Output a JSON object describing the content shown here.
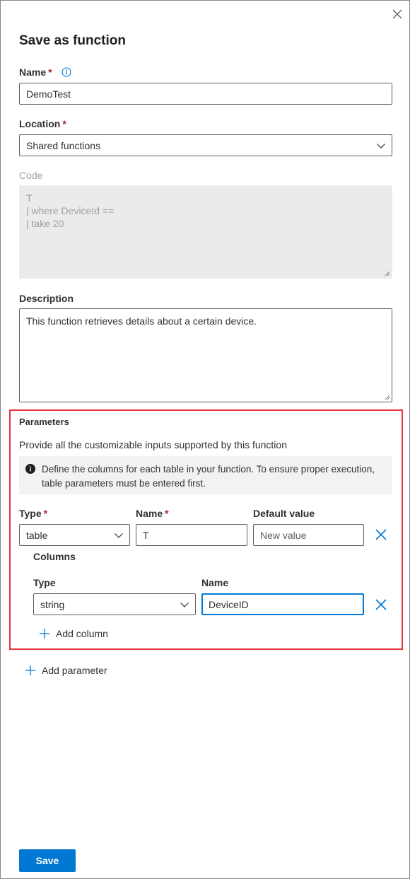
{
  "dialog": {
    "title": "Save as function"
  },
  "name_field": {
    "label": "Name",
    "required_mark": "*",
    "value": "DemoTest"
  },
  "location_field": {
    "label": "Location",
    "required_mark": "*",
    "selected": "Shared functions"
  },
  "code_field": {
    "label": "Code",
    "lines": [
      "T",
      "| where DeviceId ==",
      "| take 20"
    ]
  },
  "description_field": {
    "label": "Description",
    "value": "This function retrieves details about a certain device."
  },
  "parameters": {
    "title": "Parameters",
    "description": "Provide all the customizable inputs supported by this function",
    "info_message": "Define the columns for each table in your function. To ensure proper execution, table parameters must be entered first.",
    "headers": {
      "type": "Type",
      "name": "Name",
      "default_value": "Default value",
      "required_mark": "*"
    },
    "row": {
      "type": "table",
      "name": "T",
      "default_value_placeholder": "New value"
    },
    "columns": {
      "title": "Columns",
      "type_header": "Type",
      "name_header": "Name",
      "row": {
        "type": "string",
        "name": "DeviceID"
      },
      "add_label": "Add column"
    },
    "add_label": "Add parameter"
  },
  "footer": {
    "save_label": "Save"
  },
  "colors": {
    "accent": "#0078d4",
    "required": "#a4262c",
    "highlight_border": "#e8333a"
  }
}
